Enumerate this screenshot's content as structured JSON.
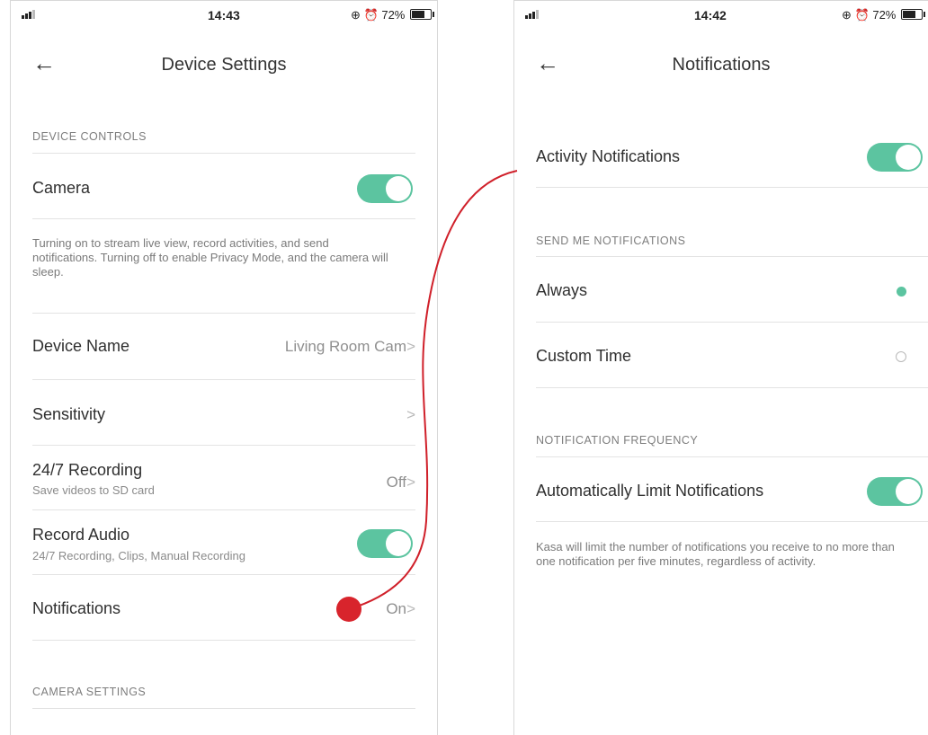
{
  "left_screen": {
    "status": {
      "time": "14:43",
      "battery": "72%"
    },
    "title": "Device Settings",
    "section_device_controls": "DEVICE CONTROLS",
    "camera_label": "Camera",
    "camera_description": "Turning on to stream live view, record activities, and send notifications. Turning off to enable Privacy Mode, and the camera will sleep.",
    "device_name_label": "Device Name",
    "device_name_value": "Living Room Cam",
    "sensitivity_label": "Sensitivity",
    "recording_label": "24/7 Recording",
    "recording_sub": "Save videos to SD card",
    "recording_value": "Off",
    "record_audio_label": "Record Audio",
    "record_audio_sub": "24/7 Recording, Clips, Manual Recording",
    "notifications_label": "Notifications",
    "notifications_value": "On",
    "section_camera_settings": "CAMERA SETTINGS"
  },
  "right_screen": {
    "status": {
      "time": "14:42",
      "battery": "72%"
    },
    "title": "Notifications",
    "activity_label": "Activity Notifications",
    "section_send": "SEND ME NOTIFICATIONS",
    "always_label": "Always",
    "custom_label": "Custom Time",
    "section_frequency": "NOTIFICATION FREQUENCY",
    "auto_limit_label": "Automatically Limit Notifications",
    "auto_limit_description": "Kasa will limit the number of notifications you receive to no more than one notification per five minutes, regardless of activity."
  },
  "icons": {
    "back": "back-arrow-icon",
    "chevron": "chevron-right-icon",
    "alarm": "alarm-icon",
    "lock": "rotation-lock-icon"
  },
  "colors": {
    "accent": "#5cc4a0",
    "connector": "#d0202a"
  }
}
